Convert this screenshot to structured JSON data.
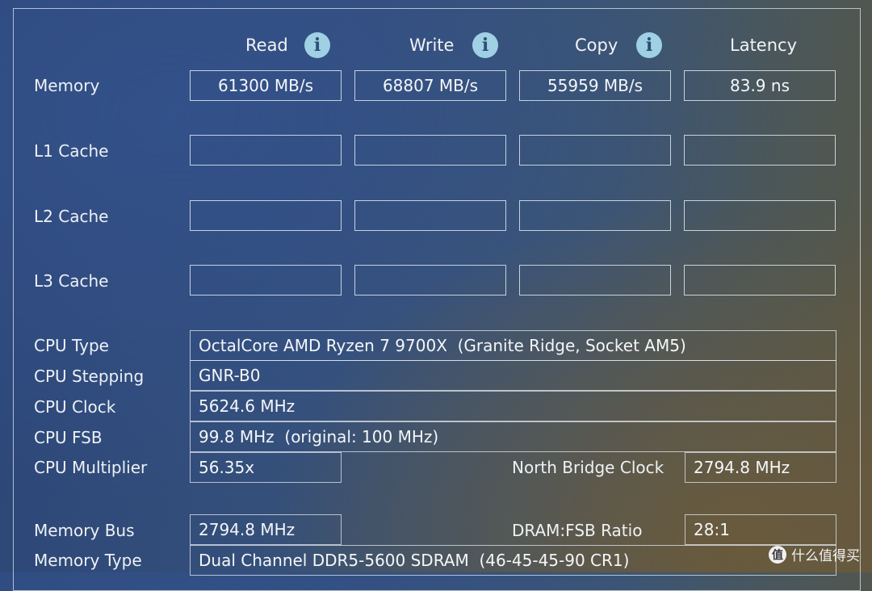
{
  "columns": {
    "read": "Read",
    "write": "Write",
    "copy": "Copy",
    "latency": "Latency",
    "info_glyph": "i"
  },
  "rows": {
    "memory": {
      "label": "Memory",
      "read": "61300 MB/s",
      "write": "68807 MB/s",
      "copy": "55959 MB/s",
      "latency": "83.9 ns"
    },
    "l1": {
      "label": "L1 Cache",
      "read": "",
      "write": "",
      "copy": "",
      "latency": ""
    },
    "l2": {
      "label": "L2 Cache",
      "read": "",
      "write": "",
      "copy": "",
      "latency": ""
    },
    "l3": {
      "label": "L3 Cache",
      "read": "",
      "write": "",
      "copy": "",
      "latency": ""
    }
  },
  "cpu": {
    "type_label": "CPU Type",
    "type": "OctalCore AMD Ryzen 7 9700X  (Granite Ridge, Socket AM5)",
    "stepping_label": "CPU Stepping",
    "stepping": "GNR-B0",
    "clock_label": "CPU Clock",
    "clock": "5624.6 MHz",
    "fsb_label": "CPU FSB",
    "fsb": "99.8 MHz  (original: 100 MHz)",
    "multiplier_label": "CPU Multiplier",
    "multiplier": "56.35x",
    "nb_clock_label": "North Bridge Clock",
    "nb_clock": "2794.8 MHz"
  },
  "memory_info": {
    "bus_label": "Memory Bus",
    "bus": "2794.8 MHz",
    "ratio_label": "DRAM:FSB Ratio",
    "ratio": "28:1",
    "type_label": "Memory Type",
    "type": "Dual Channel DDR5-5600 SDRAM  (46-45-45-90 CR1)"
  },
  "watermark": {
    "logo_glyph": "值",
    "text": "什么值得买"
  }
}
